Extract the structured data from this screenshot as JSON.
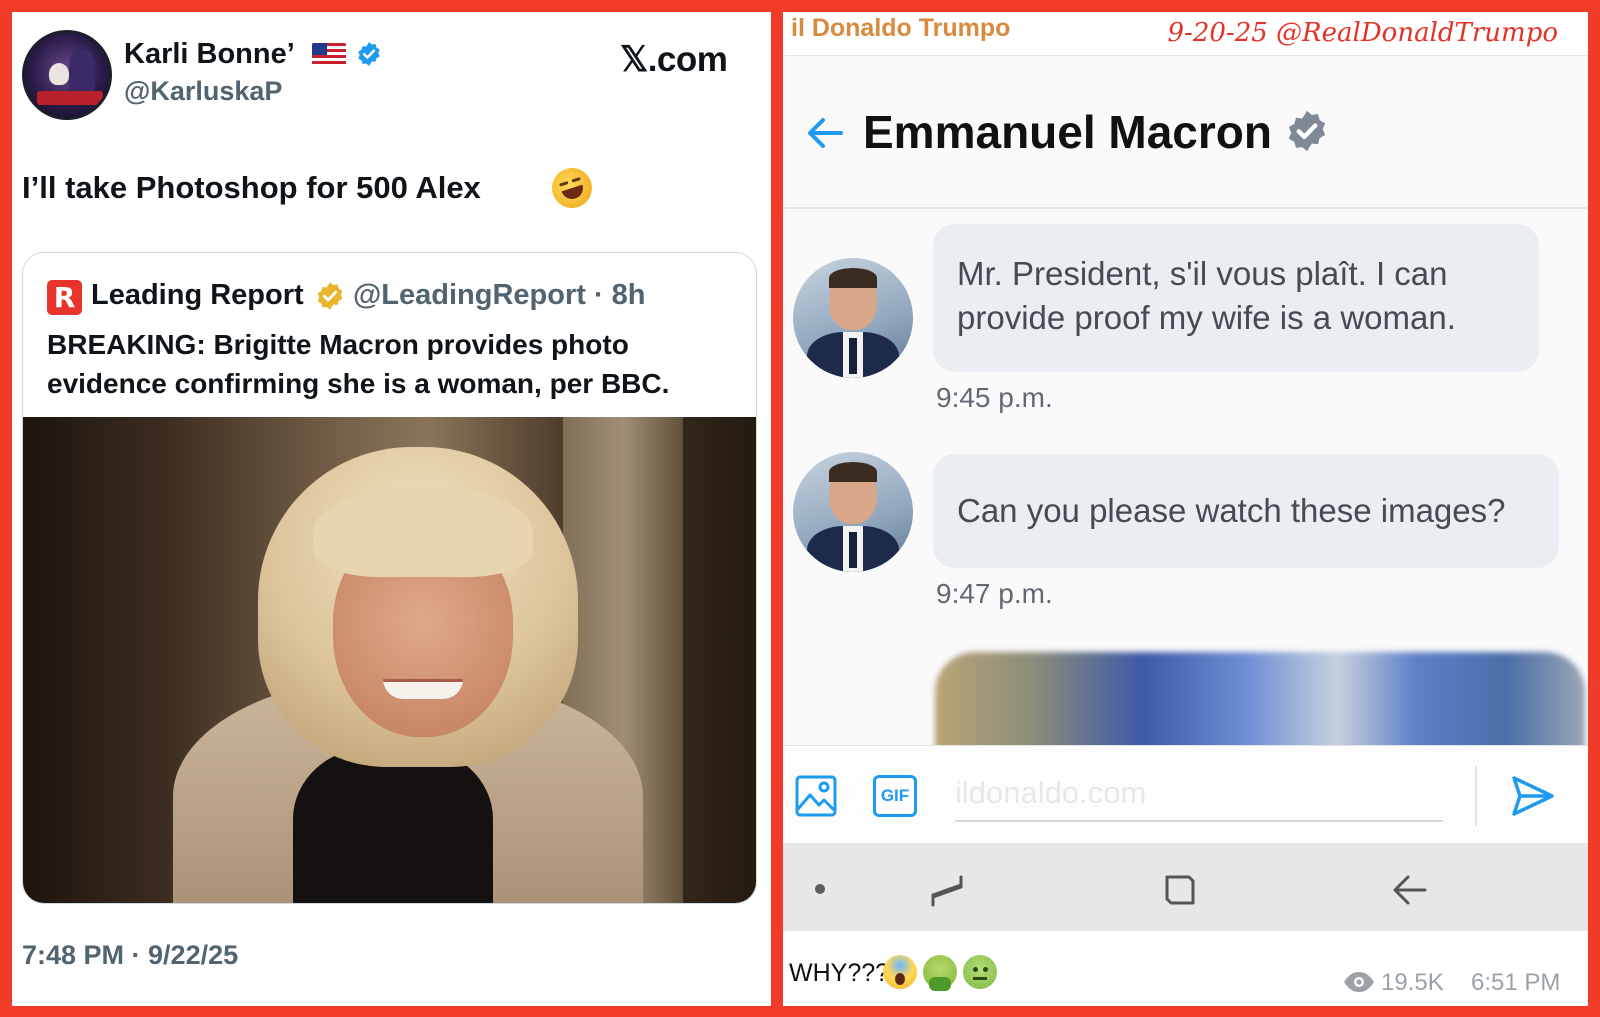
{
  "left_post": {
    "author_name": "Karli Bonne’",
    "author_handle": "@KarluskaP",
    "site_label": "𝕏.com",
    "text": "I’ll take Photoshop for 500 Alex",
    "quote": {
      "source_name": "Leading Report",
      "source_handle": "@LeadingReport · 8h",
      "logo_letter": "R",
      "headline": "BREAKING: Brigitte Macron provides photo evidence confirming she is a woman, per BBC."
    },
    "timestamp": "7:48 PM · 9/22/25"
  },
  "right_panel": {
    "brand": "il Donaldo Trumpo",
    "date_handle": "9-20-25 @RealDonaldTrumpo",
    "chat": {
      "contact_name": "Emmanuel Macron",
      "messages": [
        {
          "text": "Mr. President, s'il vous plaît. I can provide proof my wife is a woman.",
          "time": "9:45 p.m."
        },
        {
          "text": "Can you please watch these images?",
          "time": "9:47 p.m."
        }
      ],
      "composer": {
        "placeholder": "ildonaldo.com",
        "gif_label": "GIF"
      }
    },
    "caption": "WHY???",
    "views": "19.5K",
    "time": "6:51 PM"
  },
  "colors": {
    "frame": "#f03a2a",
    "twitter_blue": "#1d9bf0",
    "gold_check": "#e8b62c",
    "brand_orange": "#d88a3f",
    "date_red": "#e53226"
  },
  "icons": [
    "flag-us-icon",
    "verified-icon",
    "gold-check-icon",
    "laugh-emoji-icon",
    "back-arrow-icon",
    "image-icon",
    "gif-icon",
    "send-icon",
    "eye-icon",
    "scream-emoji-icon",
    "vomit-emoji-icon",
    "sick-emoji-icon"
  ]
}
